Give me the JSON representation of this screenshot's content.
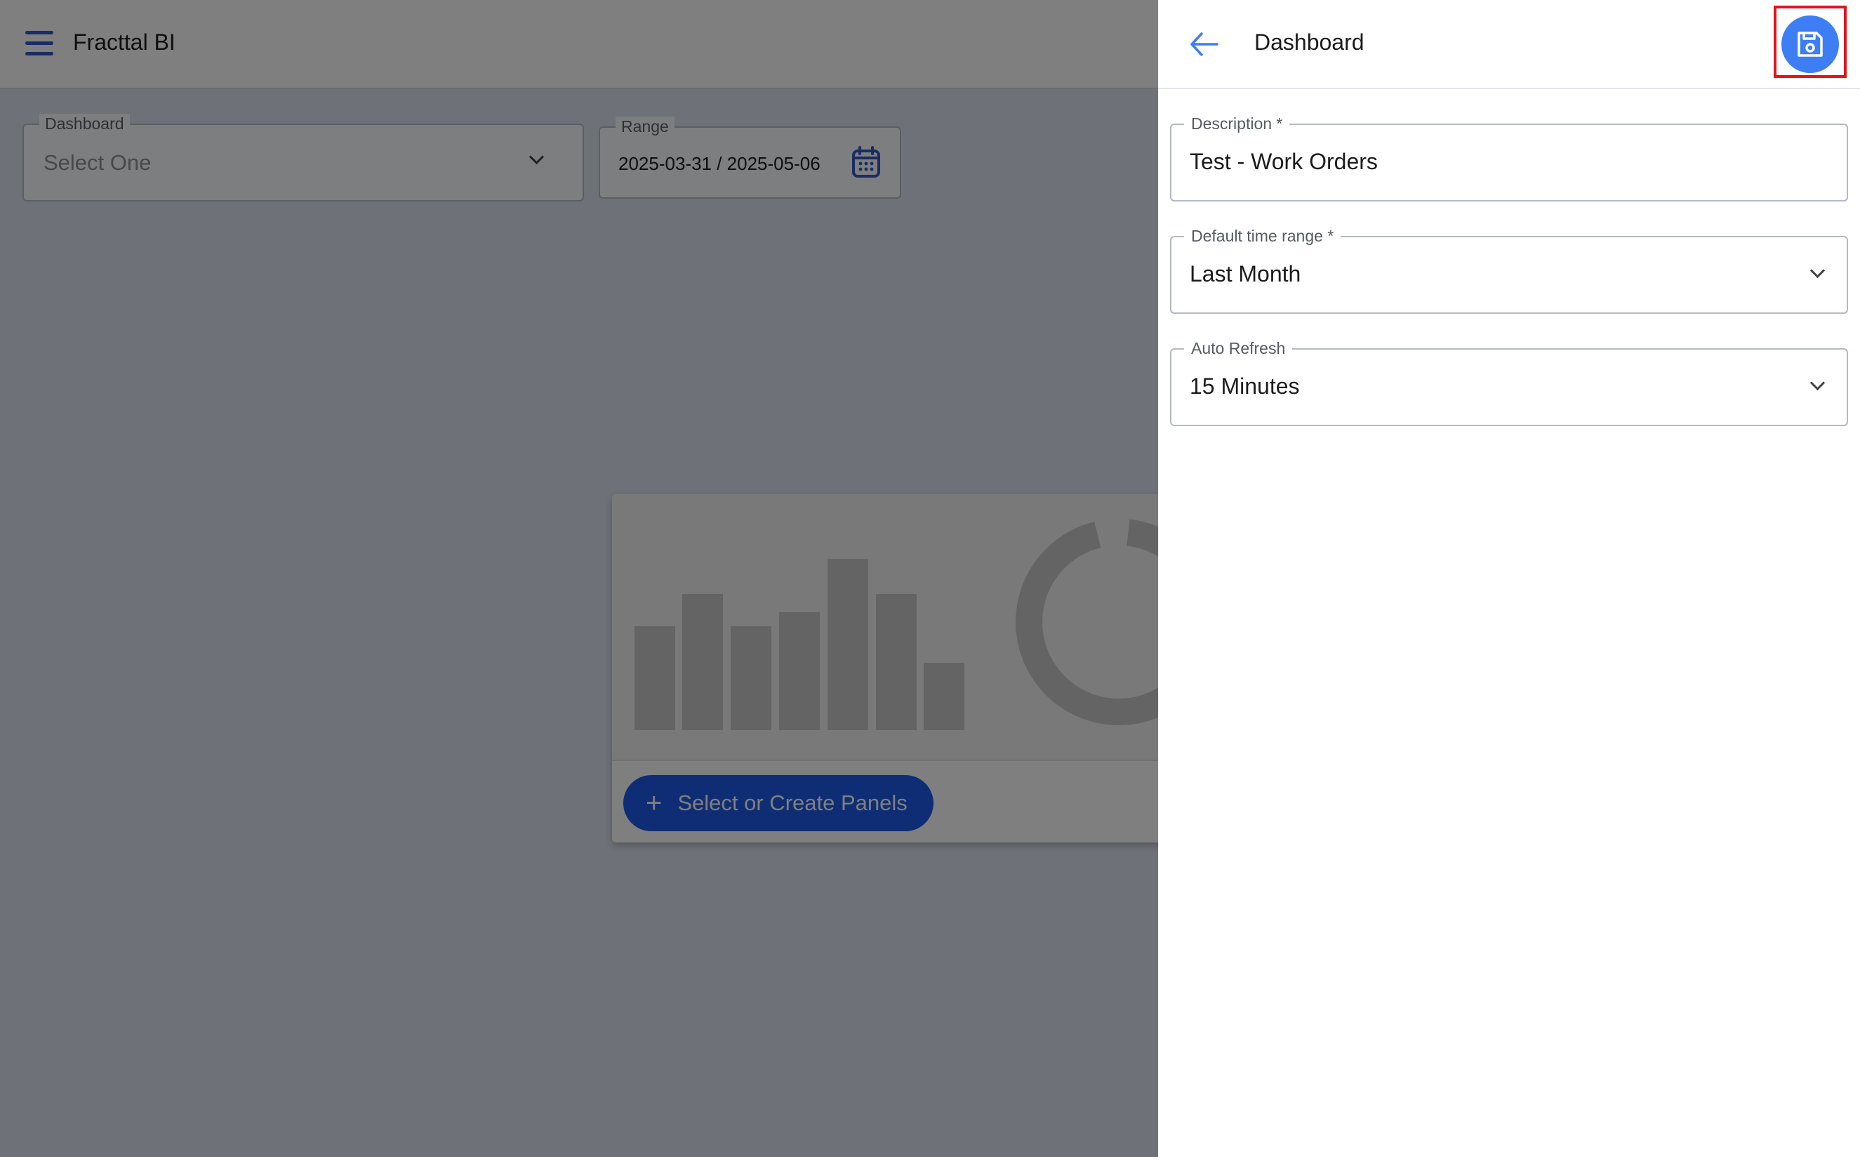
{
  "app": {
    "title": "Fracttal BI"
  },
  "filters": {
    "dashboard_label": "Dashboard",
    "dashboard_value": "Select One",
    "range_label": "Range",
    "range_value": "2025-03-31 / 2025-05-06"
  },
  "panel": {
    "button_label": "Select or Create Panels"
  },
  "drawer": {
    "title": "Dashboard",
    "description": {
      "label": "Description *",
      "value": "Test - Work Orders"
    },
    "time_range": {
      "label": "Default time range *",
      "value": "Last Month"
    },
    "auto_refresh": {
      "label": "Auto Refresh",
      "value": "15 Minutes"
    }
  },
  "colors": {
    "accent": "#3d7ef5",
    "primary_button": "#1c5aeb",
    "highlight": "#e3141a"
  },
  "icons": {
    "menu": "hamburger-icon",
    "calendar": "calendar-icon",
    "back": "arrow-left-icon",
    "save": "floppy-disk-icon",
    "add": "plus-icon",
    "dropdown": "chevron-down-icon"
  }
}
